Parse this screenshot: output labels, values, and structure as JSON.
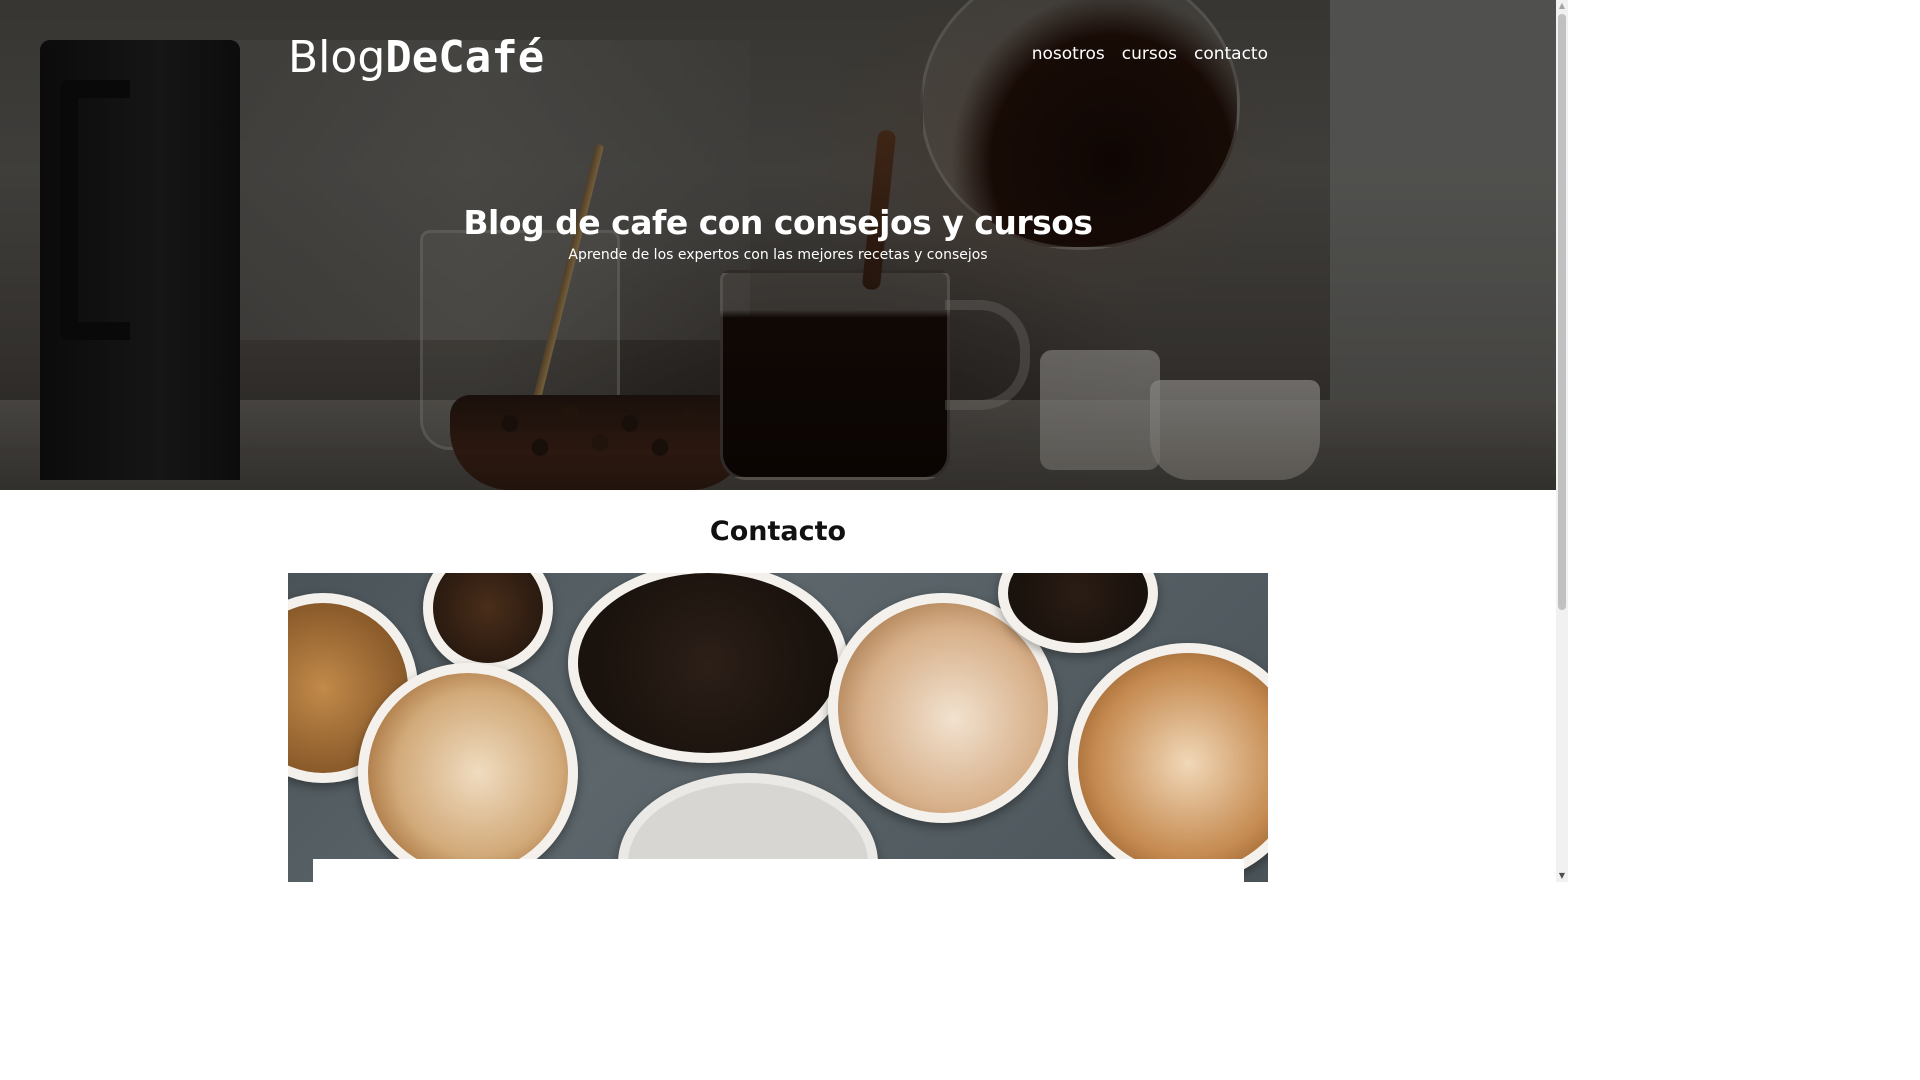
{
  "site": {
    "logo_light": "Blog",
    "logo_bold": "DeCafé"
  },
  "nav": {
    "items": [
      {
        "label": "nosotros"
      },
      {
        "label": "cursos"
      },
      {
        "label": "contacto"
      }
    ]
  },
  "hero": {
    "title": "Blog de cafe con consejos y cursos",
    "subtitle": "Aprende de los expertos con las mejores recetas y consejos",
    "image_icon": "coffee-pour-photo"
  },
  "main": {
    "title": "Contacto",
    "image_icon": "coffee-cups-photo"
  },
  "scrollbar": {
    "up_icon": "scroll-up-arrow-icon",
    "down_icon": "scroll-down-arrow-icon",
    "position": 0.0
  },
  "colors": {
    "text_dark": "#111111",
    "text_light": "#ffffff",
    "page_bg": "#ffffff"
  }
}
